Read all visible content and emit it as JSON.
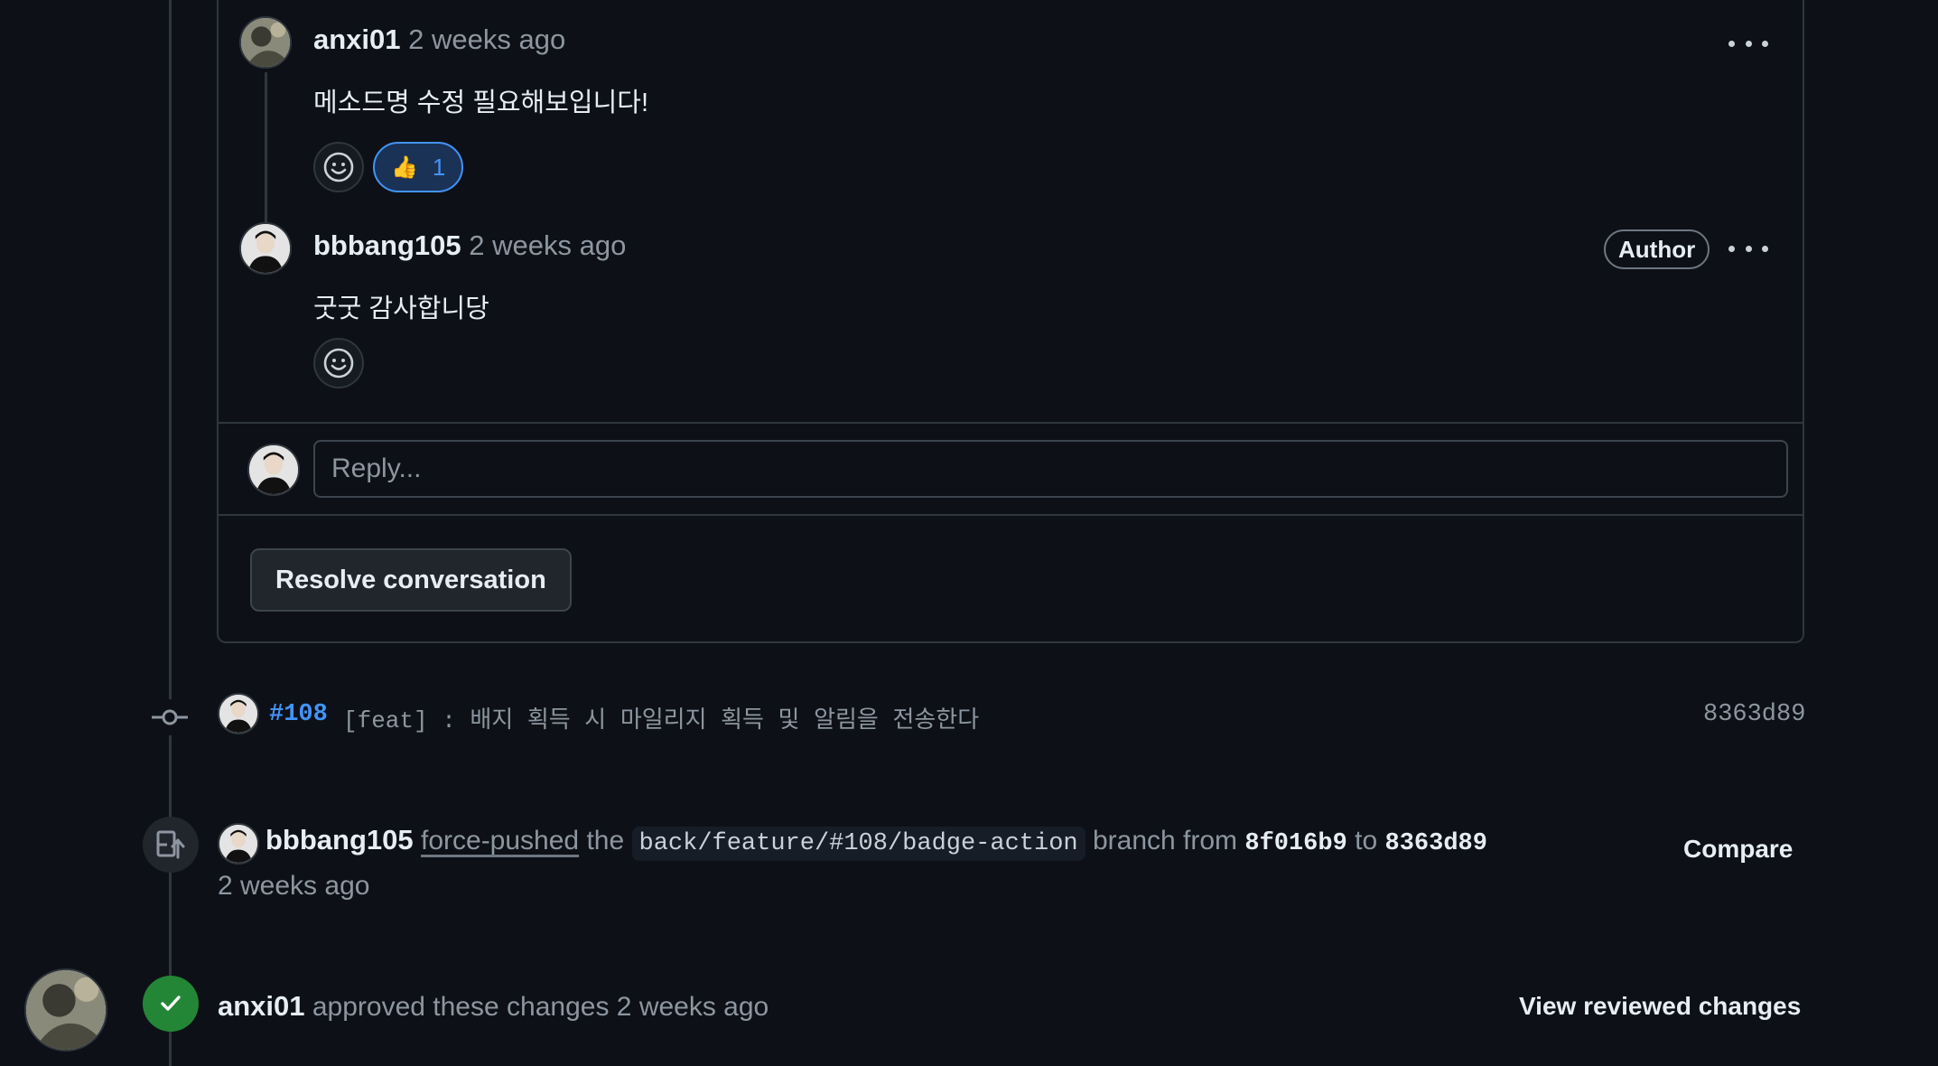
{
  "thread": {
    "comments": [
      {
        "user": "anxi01",
        "time": "2 weeks ago",
        "body": "메소드명 수정 필요해보입니다!",
        "reactions": [
          {
            "emoji": "👍",
            "count": "1"
          }
        ]
      },
      {
        "user": "bbbang105",
        "time": "2 weeks ago",
        "badge": "Author",
        "body": "굿굿 감사합니당"
      }
    ],
    "reply_placeholder": "Reply...",
    "resolve_label": "Resolve conversation"
  },
  "commit": {
    "issue": "#108",
    "message": "[feat] : 배지 획득 시 마일리지 획득 및 알림을 전송한다",
    "sha": "8363d89"
  },
  "force_push": {
    "user": "bbbang105",
    "action": "force-pushed",
    "the": "the",
    "branch": "back/feature/#108/badge-action",
    "branch_from": "branch from",
    "from_sha": "8f016b9",
    "to": "to",
    "to_sha": "8363d89",
    "time": "2 weeks ago",
    "compare_label": "Compare"
  },
  "review": {
    "user": "anxi01",
    "text": "approved these changes",
    "time": "2 weeks ago",
    "view_label": "View reviewed changes"
  },
  "colors": {
    "background": "#0d1117",
    "border": "#30363d",
    "link_blue": "#4493f8",
    "approved_green": "#238636"
  },
  "icons": {
    "kebab": "kebab-horizontal-icon",
    "smiley": "smiley-icon",
    "commit": "git-commit-icon",
    "force_push": "repo-push-icon",
    "approved": "check-icon"
  }
}
